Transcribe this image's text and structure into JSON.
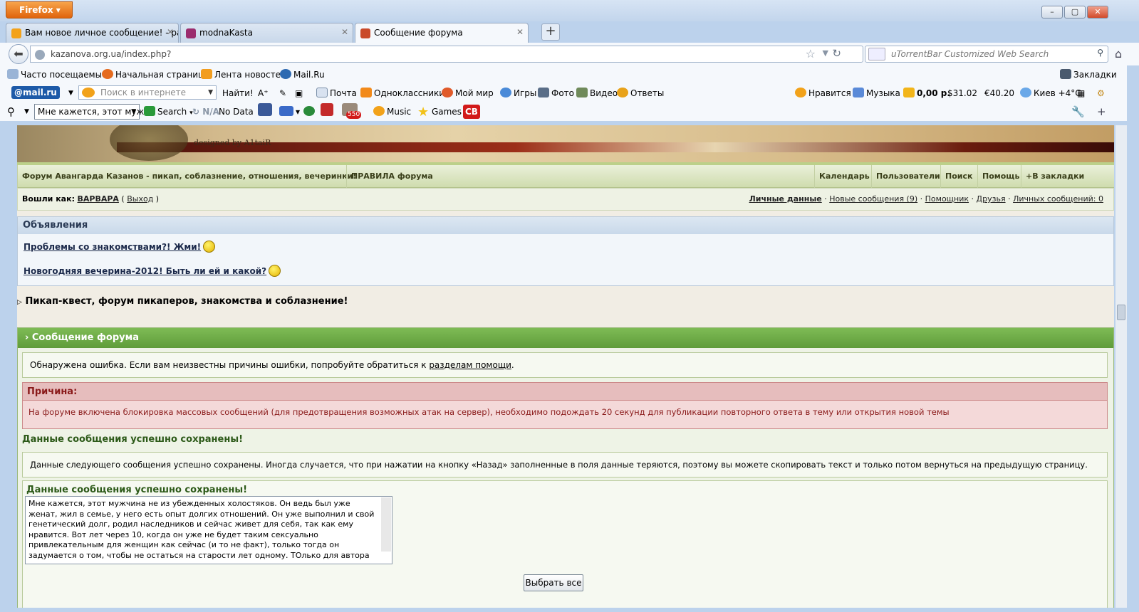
{
  "browser": {
    "menu_button": "Firefox",
    "win_min": "–",
    "win_max": "▢",
    "win_close": "✕"
  },
  "tabs": [
    {
      "label": "Вам новое личное сообщение! - ра...",
      "color": "#f3a21a"
    },
    {
      "label": "modnaKasta",
      "color": "#9b2c6e"
    },
    {
      "label": "Сообщение форума",
      "color": "#c94a2a"
    }
  ],
  "nav": {
    "url": "kazanova.org.ua/index.php?",
    "search_placeholder": "uTorrentBar Customized Web Search"
  },
  "bookmarks": {
    "items": [
      "Часто посещаемые",
      "Начальная страница",
      "Лента новостей",
      "Mail.Ru"
    ],
    "right": "Закладки"
  },
  "mailru_bar": {
    "logo": "@mail.ru",
    "search_placeholder": "Поиск в интернете",
    "find": "Найти!",
    "items": [
      "Почта",
      "Одноклассники",
      "Мой мир",
      "Игры",
      "Фото",
      "Видео",
      "Ответы"
    ],
    "right": [
      "Нравится",
      "Музыка",
      "0,00 р.",
      "31.02",
      "40.20",
      "Киев +4°C"
    ]
  },
  "utorrent_bar": {
    "query": "Мне кажется, этот муж",
    "search": "Search",
    "na": "N/A",
    "nodata": "No Data",
    "badge": "550",
    "music": "Music",
    "games": "Games"
  },
  "page": {
    "banner_credit": "designed by A1taiR",
    "forum_nav_left": [
      "Форум Авангарда Казанов - пикап, соблазнение, отношения, вечеринки!",
      "ПРАВИЛА форума"
    ],
    "forum_nav_right": [
      "Календарь",
      "Пользователи",
      "Поиск",
      "Помощь",
      "+В закладки"
    ],
    "user": {
      "prefix": "Вошли как:",
      "name": "ВАРВАРА",
      "logout": "Выход",
      "links": [
        "Личные данные",
        "Новые сообщения (9)",
        "Помощник",
        "Друзья",
        "Личных сообщений: 0"
      ]
    },
    "announcements": {
      "title": "Объявления",
      "items": [
        "Проблемы со знакомствами?! Жми!",
        "Новогодняя вечерина-2012! Быть ли ей и какой?"
      ]
    },
    "tagline": "Пикап-квест, форум пикаперов, знакомства и соблазнение!",
    "message": {
      "title": "Сообщение форума",
      "error_text": "Обнаружена ошибка. Если вам неизвестны причины ошибки, попробуйте обратиться к",
      "error_link": "разделам помощи",
      "reason_title": "Причина:",
      "reason_text": "На форуме включена блокировка массовых сообщений (для предотвращения возможных атак на сервер), необходимо подождать 20 секунд для публикации повторного ответа в тему или открытия новой темы",
      "saved_title": "Данные сообщения успешно сохранены!",
      "saved_text": "Данные следующего сообщения успешно сохранены. Иногда случается, что при нажатии на кнопку «Назад» заполненные в поля данные теряются, поэтому вы можете скопировать текст и только потом вернуться на предыдущую страницу.",
      "saved_title2": "Данные сообщения успешно сохранены!",
      "textarea": "Мне кажется, этот мужчина не из убежденных холостяков. Он ведь был уже женат, жил в семье, у него есть опыт долгих отношений. Он уже выполнил и свой генетический долг, родил наследников и сейчас  живет для себя, так как ему нравится. Вот лет через 10, когда он уже не будет таким сексуально привлекательным для женщин как сейчас (и то не факт), только тогда он задумается о том, чтобы не остаться на старости лет одному. ТОлько для автора",
      "select_all": "Выбрать все"
    }
  }
}
